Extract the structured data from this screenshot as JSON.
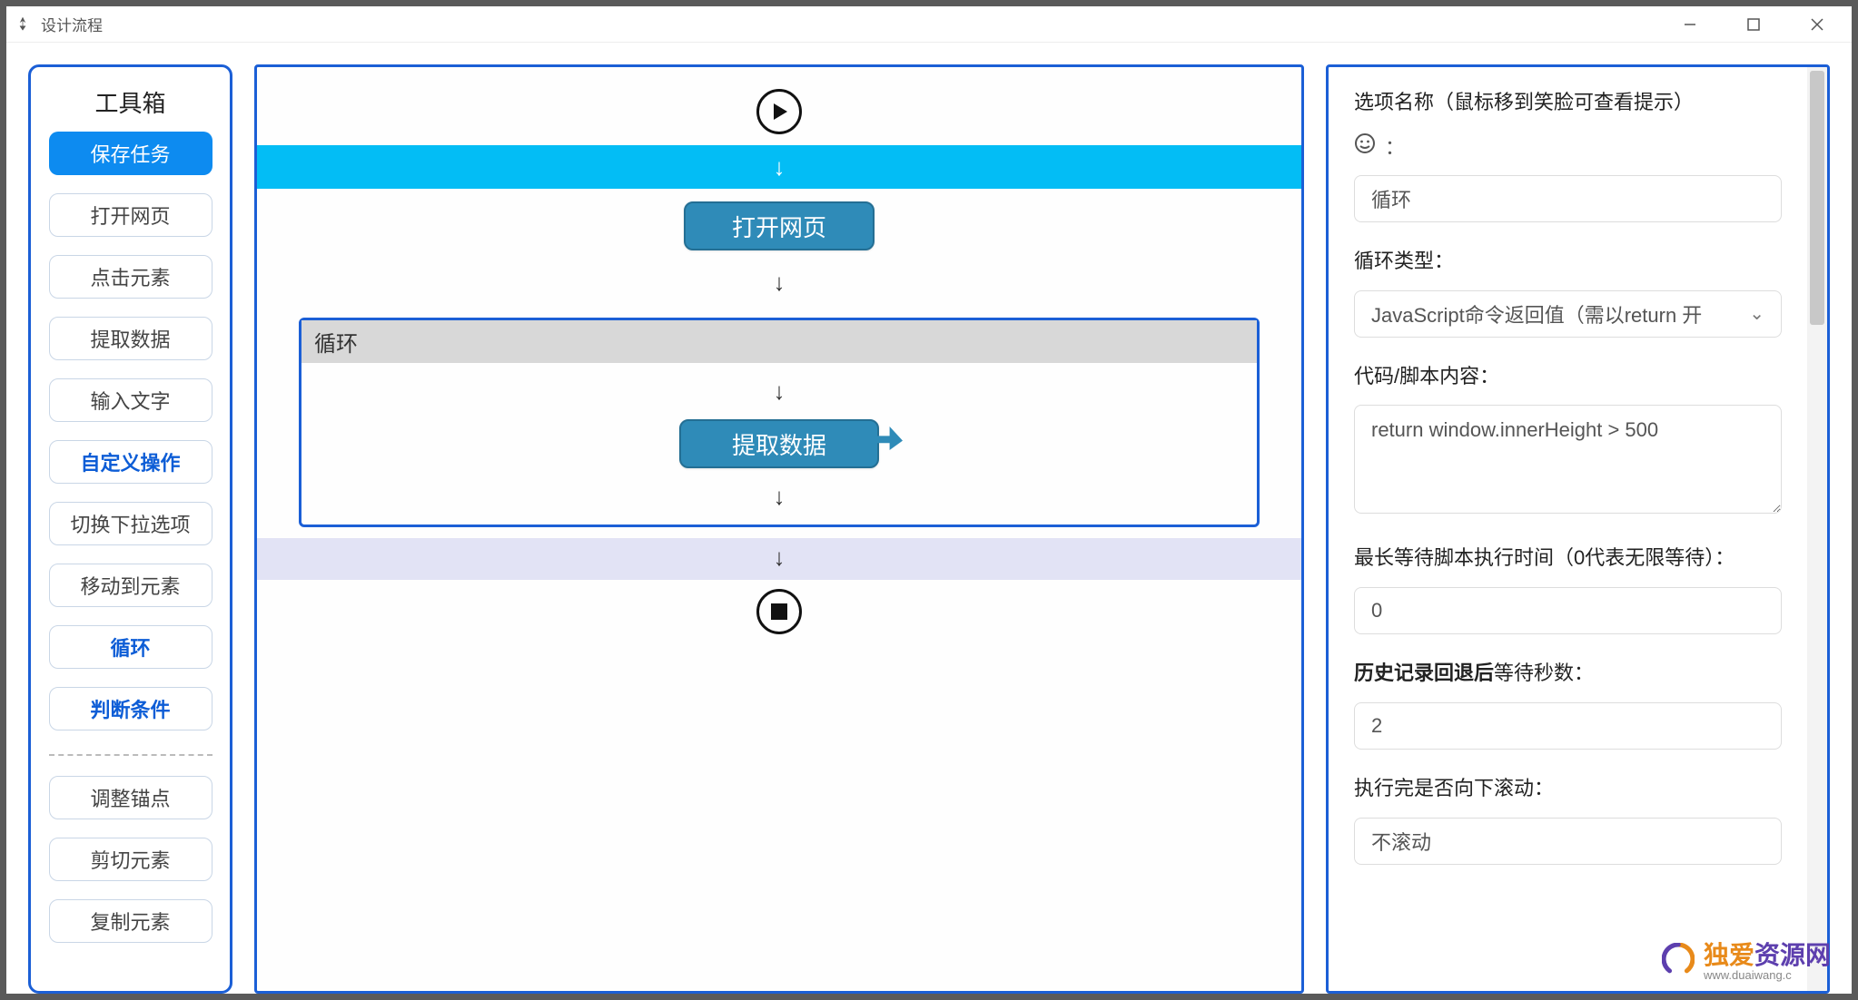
{
  "window": {
    "title": "设计流程"
  },
  "sidebar": {
    "title": "工具箱",
    "primary": "保存任务",
    "items": [
      "打开网页",
      "点击元素",
      "提取数据",
      "输入文字",
      "自定义操作",
      "切换下拉选项",
      "移动到元素",
      "循环",
      "判断条件"
    ],
    "items2": [
      "调整锚点",
      "剪切元素",
      "复制元素"
    ]
  },
  "flow": {
    "arrow": "↓",
    "open_page": "打开网页",
    "loop_title": "循环",
    "extract": "提取数据"
  },
  "panel": {
    "heading": "选项名称（鼠标移到笑脸可查看提示）",
    "smiley_suffix": "：",
    "name_value": "循环",
    "loop_type_label": "循环类型：",
    "loop_type_value": "JavaScript命令返回值（需以return 开",
    "code_label": "代码/脚本内容：",
    "code_value": "return window.innerHeight > 500",
    "wait_label": "最长等待脚本执行时间（0代表无限等待）：",
    "wait_value": "0",
    "back_label_bold": "历史记录回退后",
    "back_label_rest": "等待秒数：",
    "back_value": "2",
    "scroll_label": "执行完是否向下滚动：",
    "scroll_value": "不滚动"
  },
  "watermark": {
    "primary": "独爱资源网",
    "sub": "www.duaiwang.c"
  }
}
